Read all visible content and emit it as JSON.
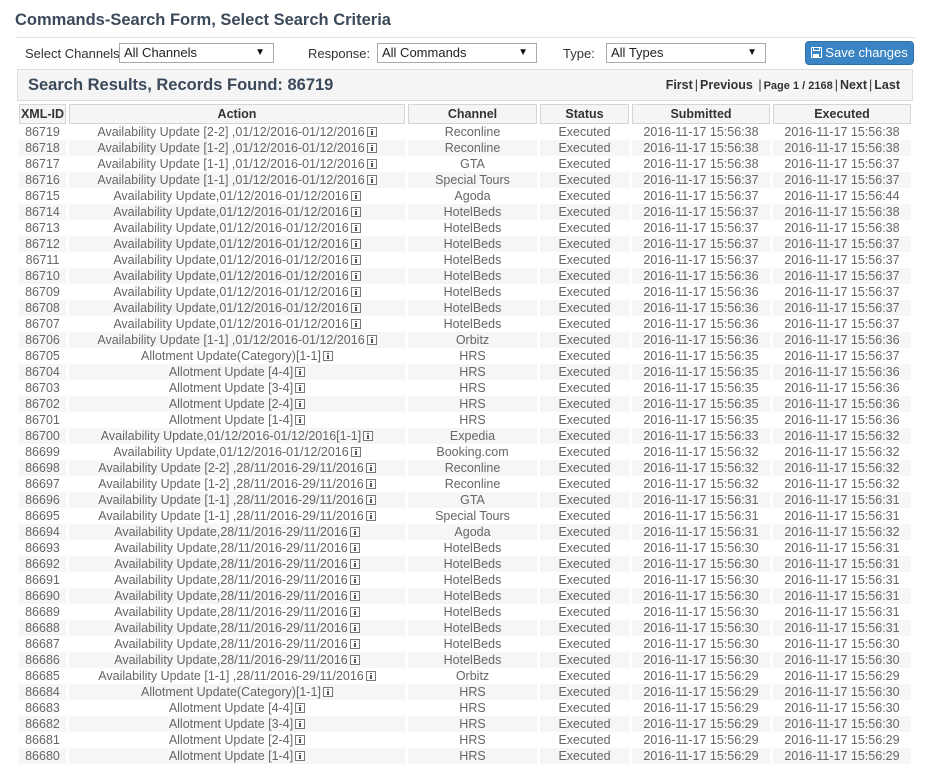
{
  "page": {
    "title": "Commands-Search Form, Select Search Criteria"
  },
  "filters": {
    "channels_label": "Select Channels:",
    "channels_value": "All Channels",
    "response_label": "Response:",
    "response_value": "All Commands",
    "type_label": "Type:",
    "type_value": "All Types",
    "save_label": "Save changes",
    "save_icon": "floppy-disk-icon"
  },
  "results": {
    "title": "Search Results,  Records Found: 86719",
    "pager": {
      "first": "First",
      "previous": "Previous",
      "page_info": "Page 1 / 2168",
      "next": "Next",
      "last": "Last"
    },
    "columns": [
      "XML-ID",
      "Action",
      "Channel",
      "Status",
      "Submitted",
      "Executed"
    ],
    "row_icon": "info-icon",
    "rows": [
      {
        "id": "86719",
        "action": "Availability Update [2-2] ,01/12/2016-01/12/2016",
        "channel": "Reconline",
        "status": "Executed",
        "submitted": "2016-11-17 15:56:38",
        "executed": "2016-11-17 15:56:38"
      },
      {
        "id": "86718",
        "action": "Availability Update [1-2] ,01/12/2016-01/12/2016",
        "channel": "Reconline",
        "status": "Executed",
        "submitted": "2016-11-17 15:56:38",
        "executed": "2016-11-17 15:56:38"
      },
      {
        "id": "86717",
        "action": "Availability Update [1-1] ,01/12/2016-01/12/2016",
        "channel": "GTA",
        "status": "Executed",
        "submitted": "2016-11-17 15:56:38",
        "executed": "2016-11-17 15:56:37"
      },
      {
        "id": "86716",
        "action": "Availability Update [1-1] ,01/12/2016-01/12/2016",
        "channel": "Special Tours",
        "status": "Executed",
        "submitted": "2016-11-17 15:56:37",
        "executed": "2016-11-17 15:56:37"
      },
      {
        "id": "86715",
        "action": "Availability Update,01/12/2016-01/12/2016",
        "channel": "Agoda",
        "status": "Executed",
        "submitted": "2016-11-17 15:56:37",
        "executed": "2016-11-17 15:56:44"
      },
      {
        "id": "86714",
        "action": "Availability Update,01/12/2016-01/12/2016",
        "channel": "HotelBeds",
        "status": "Executed",
        "submitted": "2016-11-17 15:56:37",
        "executed": "2016-11-17 15:56:38"
      },
      {
        "id": "86713",
        "action": "Availability Update,01/12/2016-01/12/2016",
        "channel": "HotelBeds",
        "status": "Executed",
        "submitted": "2016-11-17 15:56:37",
        "executed": "2016-11-17 15:56:38"
      },
      {
        "id": "86712",
        "action": "Availability Update,01/12/2016-01/12/2016",
        "channel": "HotelBeds",
        "status": "Executed",
        "submitted": "2016-11-17 15:56:37",
        "executed": "2016-11-17 15:56:37"
      },
      {
        "id": "86711",
        "action": "Availability Update,01/12/2016-01/12/2016",
        "channel": "HotelBeds",
        "status": "Executed",
        "submitted": "2016-11-17 15:56:37",
        "executed": "2016-11-17 15:56:37"
      },
      {
        "id": "86710",
        "action": "Availability Update,01/12/2016-01/12/2016",
        "channel": "HotelBeds",
        "status": "Executed",
        "submitted": "2016-11-17 15:56:36",
        "executed": "2016-11-17 15:56:37"
      },
      {
        "id": "86709",
        "action": "Availability Update,01/12/2016-01/12/2016",
        "channel": "HotelBeds",
        "status": "Executed",
        "submitted": "2016-11-17 15:56:36",
        "executed": "2016-11-17 15:56:37"
      },
      {
        "id": "86708",
        "action": "Availability Update,01/12/2016-01/12/2016",
        "channel": "HotelBeds",
        "status": "Executed",
        "submitted": "2016-11-17 15:56:36",
        "executed": "2016-11-17 15:56:37"
      },
      {
        "id": "86707",
        "action": "Availability Update,01/12/2016-01/12/2016",
        "channel": "HotelBeds",
        "status": "Executed",
        "submitted": "2016-11-17 15:56:36",
        "executed": "2016-11-17 15:56:37"
      },
      {
        "id": "86706",
        "action": "Availability Update [1-1] ,01/12/2016-01/12/2016",
        "channel": "Orbitz",
        "status": "Executed",
        "submitted": "2016-11-17 15:56:36",
        "executed": "2016-11-17 15:56:36"
      },
      {
        "id": "86705",
        "action": "Allotment Update(Category)[1-1]",
        "channel": "HRS",
        "status": "Executed",
        "submitted": "2016-11-17 15:56:35",
        "executed": "2016-11-17 15:56:37"
      },
      {
        "id": "86704",
        "action": "Allotment Update [4-4]",
        "channel": "HRS",
        "status": "Executed",
        "submitted": "2016-11-17 15:56:35",
        "executed": "2016-11-17 15:56:36"
      },
      {
        "id": "86703",
        "action": "Allotment Update [3-4]",
        "channel": "HRS",
        "status": "Executed",
        "submitted": "2016-11-17 15:56:35",
        "executed": "2016-11-17 15:56:36"
      },
      {
        "id": "86702",
        "action": "Allotment Update [2-4]",
        "channel": "HRS",
        "status": "Executed",
        "submitted": "2016-11-17 15:56:35",
        "executed": "2016-11-17 15:56:36"
      },
      {
        "id": "86701",
        "action": "Allotment Update [1-4]",
        "channel": "HRS",
        "status": "Executed",
        "submitted": "2016-11-17 15:56:35",
        "executed": "2016-11-17 15:56:36"
      },
      {
        "id": "86700",
        "action": "Availability Update,01/12/2016-01/12/2016[1-1]",
        "channel": "Expedia",
        "status": "Executed",
        "submitted": "2016-11-17 15:56:33",
        "executed": "2016-11-17 15:56:32"
      },
      {
        "id": "86699",
        "action": "Availability Update,01/12/2016-01/12/2016",
        "channel": "Booking.com",
        "status": "Executed",
        "submitted": "2016-11-17 15:56:32",
        "executed": "2016-11-17 15:56:32"
      },
      {
        "id": "86698",
        "action": "Availability Update [2-2] ,28/11/2016-29/11/2016",
        "channel": "Reconline",
        "status": "Executed",
        "submitted": "2016-11-17 15:56:32",
        "executed": "2016-11-17 15:56:32"
      },
      {
        "id": "86697",
        "action": "Availability Update [1-2] ,28/11/2016-29/11/2016",
        "channel": "Reconline",
        "status": "Executed",
        "submitted": "2016-11-17 15:56:32",
        "executed": "2016-11-17 15:56:32"
      },
      {
        "id": "86696",
        "action": "Availability Update [1-1] ,28/11/2016-29/11/2016",
        "channel": "GTA",
        "status": "Executed",
        "submitted": "2016-11-17 15:56:31",
        "executed": "2016-11-17 15:56:31"
      },
      {
        "id": "86695",
        "action": "Availability Update [1-1] ,28/11/2016-29/11/2016",
        "channel": "Special Tours",
        "status": "Executed",
        "submitted": "2016-11-17 15:56:31",
        "executed": "2016-11-17 15:56:31"
      },
      {
        "id": "86694",
        "action": "Availability Update,28/11/2016-29/11/2016",
        "channel": "Agoda",
        "status": "Executed",
        "submitted": "2016-11-17 15:56:31",
        "executed": "2016-11-17 15:56:32"
      },
      {
        "id": "86693",
        "action": "Availability Update,28/11/2016-29/11/2016",
        "channel": "HotelBeds",
        "status": "Executed",
        "submitted": "2016-11-17 15:56:30",
        "executed": "2016-11-17 15:56:31"
      },
      {
        "id": "86692",
        "action": "Availability Update,28/11/2016-29/11/2016",
        "channel": "HotelBeds",
        "status": "Executed",
        "submitted": "2016-11-17 15:56:30",
        "executed": "2016-11-17 15:56:31"
      },
      {
        "id": "86691",
        "action": "Availability Update,28/11/2016-29/11/2016",
        "channel": "HotelBeds",
        "status": "Executed",
        "submitted": "2016-11-17 15:56:30",
        "executed": "2016-11-17 15:56:31"
      },
      {
        "id": "86690",
        "action": "Availability Update,28/11/2016-29/11/2016",
        "channel": "HotelBeds",
        "status": "Executed",
        "submitted": "2016-11-17 15:56:30",
        "executed": "2016-11-17 15:56:31"
      },
      {
        "id": "86689",
        "action": "Availability Update,28/11/2016-29/11/2016",
        "channel": "HotelBeds",
        "status": "Executed",
        "submitted": "2016-11-17 15:56:30",
        "executed": "2016-11-17 15:56:31"
      },
      {
        "id": "86688",
        "action": "Availability Update,28/11/2016-29/11/2016",
        "channel": "HotelBeds",
        "status": "Executed",
        "submitted": "2016-11-17 15:56:30",
        "executed": "2016-11-17 15:56:31"
      },
      {
        "id": "86687",
        "action": "Availability Update,28/11/2016-29/11/2016",
        "channel": "HotelBeds",
        "status": "Executed",
        "submitted": "2016-11-17 15:56:30",
        "executed": "2016-11-17 15:56:30"
      },
      {
        "id": "86686",
        "action": "Availability Update,28/11/2016-29/11/2016",
        "channel": "HotelBeds",
        "status": "Executed",
        "submitted": "2016-11-17 15:56:30",
        "executed": "2016-11-17 15:56:30"
      },
      {
        "id": "86685",
        "action": "Availability Update [1-1] ,28/11/2016-29/11/2016",
        "channel": "Orbitz",
        "status": "Executed",
        "submitted": "2016-11-17 15:56:29",
        "executed": "2016-11-17 15:56:29"
      },
      {
        "id": "86684",
        "action": "Allotment Update(Category)[1-1]",
        "channel": "HRS",
        "status": "Executed",
        "submitted": "2016-11-17 15:56:29",
        "executed": "2016-11-17 15:56:30"
      },
      {
        "id": "86683",
        "action": "Allotment Update [4-4]",
        "channel": "HRS",
        "status": "Executed",
        "submitted": "2016-11-17 15:56:29",
        "executed": "2016-11-17 15:56:30"
      },
      {
        "id": "86682",
        "action": "Allotment Update [3-4]",
        "channel": "HRS",
        "status": "Executed",
        "submitted": "2016-11-17 15:56:29",
        "executed": "2016-11-17 15:56:30"
      },
      {
        "id": "86681",
        "action": "Allotment Update [2-4]",
        "channel": "HRS",
        "status": "Executed",
        "submitted": "2016-11-17 15:56:29",
        "executed": "2016-11-17 15:56:29"
      },
      {
        "id": "86680",
        "action": "Allotment Update [1-4]",
        "channel": "HRS",
        "status": "Executed",
        "submitted": "2016-11-17 15:56:29",
        "executed": "2016-11-17 15:56:29"
      }
    ]
  }
}
